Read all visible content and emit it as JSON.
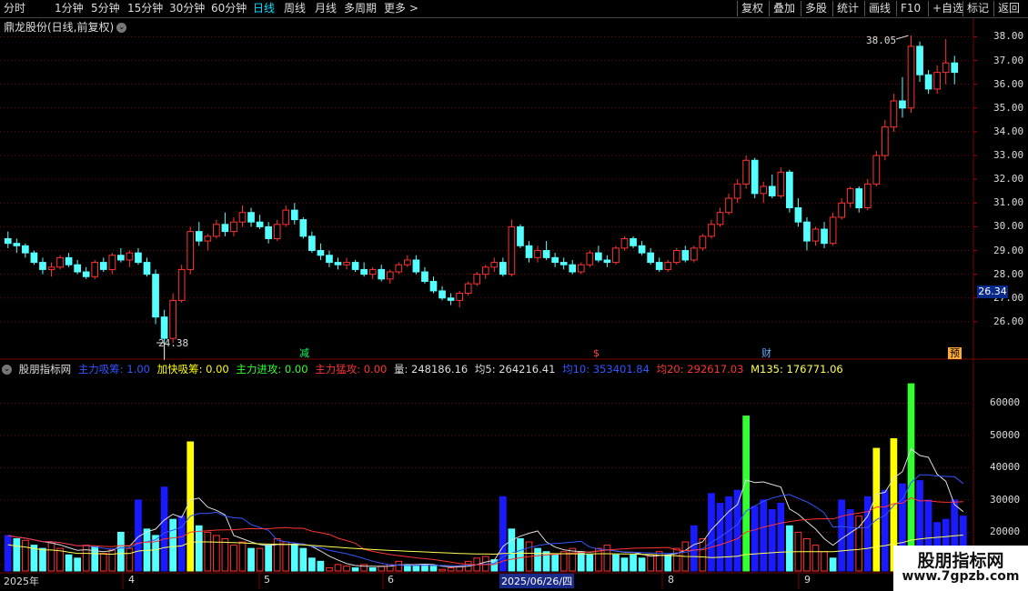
{
  "toolbar": {
    "periods": [
      "分时",
      "1分钟",
      "5分钟",
      "15分钟",
      "30分钟",
      "60分钟",
      "日线",
      "周线",
      "月线",
      "多周期",
      "更多 >"
    ],
    "active_index": 6,
    "right_buttons": [
      "复权",
      "叠加",
      "多股",
      "统计",
      "画线",
      "F10",
      "+自选",
      "标记",
      "返回"
    ]
  },
  "stock": {
    "title": "鼎龙股份(日线,前复权)",
    "dot_icon": "chevron-down-icon"
  },
  "price_axis": {
    "labels": [
      "38.00",
      "37.00",
      "36.00",
      "35.00",
      "34.00",
      "33.00",
      "32.00",
      "31.00",
      "30.00",
      "29.00",
      "28.00",
      "27.00",
      "26.00"
    ],
    "current_price": "26.34"
  },
  "annotations": {
    "high_label": "38.05",
    "low_label": "24.38"
  },
  "markers": [
    {
      "text": "减",
      "color": "#00ff66"
    },
    {
      "text": "$",
      "color": "#ff4444"
    },
    {
      "text": "财",
      "color": "#66aaff"
    },
    {
      "text": "预",
      "color": "#ffaa33"
    }
  ],
  "indicator": {
    "name": "股朋指标网",
    "items": [
      {
        "label": "主力吸筹: 1.00",
        "color": "#3355ff"
      },
      {
        "label": "加快吸筹: 0.00",
        "color": "#ffff00"
      },
      {
        "label": "主力进攻: 0.00",
        "color": "#33ff33"
      },
      {
        "label": "主力猛攻: 0.00",
        "color": "#ff3333"
      },
      {
        "label": "量: 248186.16",
        "color": "#dddddd"
      },
      {
        "label": "均5: 264216.41",
        "color": "#dddddd"
      },
      {
        "label": "均10: 353401.84",
        "color": "#3355ff"
      },
      {
        "label": "均20: 292617.03",
        "color": "#ff3333"
      },
      {
        "label": "M135: 176771.06",
        "color": "#ffff55"
      }
    ]
  },
  "volume_axis": {
    "labels": [
      "60000",
      "50000",
      "40000",
      "30000",
      "20000",
      "10000"
    ]
  },
  "dates": [
    "2025年",
    "4",
    "5",
    "6",
    "2025/06/26/四",
    "8",
    "9"
  ],
  "watermark": {
    "line1": "股朋指标网",
    "line2": "www.7gpzb.com"
  },
  "colors": {
    "up": "#ff3232",
    "down": "#54ffff",
    "grid": "#7a0000",
    "vol_blue": "#1a1aff",
    "vol_yellow": "#ffff00",
    "vol_green": "#33ff33"
  },
  "chart_data": {
    "type": "candlestick",
    "ylim": [
      25.0,
      38.4
    ],
    "candles": [
      [
        29.5,
        29.8,
        29.1,
        29.3
      ],
      [
        29.3,
        29.5,
        28.9,
        29.2
      ],
      [
        29.2,
        29.3,
        28.7,
        28.9
      ],
      [
        28.9,
        29.0,
        28.4,
        28.5
      ],
      [
        28.5,
        28.7,
        28.0,
        28.2
      ],
      [
        28.2,
        28.5,
        27.9,
        28.3
      ],
      [
        28.3,
        28.8,
        28.2,
        28.7
      ],
      [
        28.7,
        28.9,
        28.3,
        28.4
      ],
      [
        28.4,
        28.6,
        28.0,
        28.1
      ],
      [
        28.1,
        28.3,
        27.8,
        27.9
      ],
      [
        27.9,
        28.6,
        27.8,
        28.5
      ],
      [
        28.5,
        28.7,
        28.1,
        28.2
      ],
      [
        28.2,
        28.9,
        28.0,
        28.8
      ],
      [
        28.8,
        29.1,
        28.5,
        28.6
      ],
      [
        28.6,
        29.0,
        28.3,
        28.9
      ],
      [
        28.9,
        29.1,
        28.4,
        28.5
      ],
      [
        28.5,
        28.7,
        27.9,
        28.0
      ],
      [
        28.0,
        28.2,
        25.9,
        26.2
      ],
      [
        26.2,
        26.5,
        24.4,
        25.3
      ],
      [
        25.3,
        27.2,
        25.1,
        26.9
      ],
      [
        26.9,
        28.4,
        26.8,
        28.2
      ],
      [
        28.2,
        30.0,
        28.0,
        29.8
      ],
      [
        29.8,
        30.2,
        29.2,
        29.4
      ],
      [
        29.4,
        29.7,
        29.0,
        29.6
      ],
      [
        29.6,
        30.3,
        29.5,
        30.1
      ],
      [
        30.1,
        30.6,
        29.6,
        29.8
      ],
      [
        29.8,
        30.4,
        29.6,
        30.2
      ],
      [
        30.2,
        30.9,
        30.0,
        30.6
      ],
      [
        30.6,
        30.8,
        30.0,
        30.2
      ],
      [
        30.2,
        30.5,
        29.9,
        30.0
      ],
      [
        30.0,
        30.2,
        29.3,
        29.5
      ],
      [
        29.5,
        30.3,
        29.4,
        30.1
      ],
      [
        30.1,
        30.9,
        30.0,
        30.7
      ],
      [
        30.7,
        31.0,
        30.1,
        30.3
      ],
      [
        30.3,
        30.4,
        29.5,
        29.6
      ],
      [
        29.6,
        29.8,
        28.9,
        29.0
      ],
      [
        29.0,
        29.3,
        28.6,
        28.8
      ],
      [
        28.8,
        29.0,
        28.3,
        28.5
      ],
      [
        28.5,
        28.7,
        28.2,
        28.4
      ],
      [
        28.4,
        28.7,
        28.2,
        28.5
      ],
      [
        28.5,
        28.6,
        28.1,
        28.2
      ],
      [
        28.2,
        28.5,
        27.9,
        28.0
      ],
      [
        28.0,
        28.3,
        27.8,
        28.2
      ],
      [
        28.2,
        28.4,
        27.7,
        27.8
      ],
      [
        27.8,
        28.2,
        27.6,
        28.1
      ],
      [
        28.1,
        28.5,
        28.0,
        28.4
      ],
      [
        28.4,
        28.8,
        28.3,
        28.6
      ],
      [
        28.6,
        28.8,
        28.0,
        28.1
      ],
      [
        28.1,
        28.3,
        27.6,
        27.7
      ],
      [
        27.7,
        27.9,
        27.2,
        27.3
      ],
      [
        27.3,
        27.5,
        26.9,
        27.0
      ],
      [
        27.0,
        27.2,
        26.7,
        26.9
      ],
      [
        26.9,
        27.3,
        26.6,
        27.2
      ],
      [
        27.2,
        27.7,
        27.1,
        27.6
      ],
      [
        27.6,
        28.1,
        27.5,
        28.0
      ],
      [
        28.0,
        28.4,
        27.8,
        28.3
      ],
      [
        28.3,
        28.7,
        28.1,
        28.5
      ],
      [
        28.5,
        28.7,
        27.9,
        28.0
      ],
      [
        28.0,
        30.3,
        27.9,
        30.0
      ],
      [
        30.0,
        30.1,
        29.1,
        29.2
      ],
      [
        29.2,
        29.4,
        28.5,
        28.7
      ],
      [
        28.7,
        29.2,
        28.5,
        29.0
      ],
      [
        29.0,
        29.4,
        28.6,
        28.7
      ],
      [
        28.7,
        28.9,
        28.3,
        28.5
      ],
      [
        28.5,
        28.7,
        28.2,
        28.4
      ],
      [
        28.4,
        28.6,
        28.0,
        28.1
      ],
      [
        28.1,
        28.5,
        28.0,
        28.4
      ],
      [
        28.4,
        29.0,
        28.3,
        28.9
      ],
      [
        28.9,
        29.2,
        28.5,
        28.6
      ],
      [
        28.6,
        28.8,
        28.3,
        28.5
      ],
      [
        28.5,
        29.2,
        28.4,
        29.1
      ],
      [
        29.1,
        29.6,
        29.0,
        29.5
      ],
      [
        29.5,
        29.6,
        29.1,
        29.2
      ],
      [
        29.2,
        29.4,
        28.8,
        28.9
      ],
      [
        28.9,
        29.1,
        28.4,
        28.5
      ],
      [
        28.5,
        28.7,
        28.1,
        28.2
      ],
      [
        28.2,
        28.6,
        28.1,
        28.5
      ],
      [
        28.5,
        29.1,
        28.4,
        29.0
      ],
      [
        29.0,
        29.2,
        28.5,
        28.6
      ],
      [
        28.6,
        29.2,
        28.5,
        29.1
      ],
      [
        29.1,
        29.7,
        29.0,
        29.6
      ],
      [
        29.6,
        30.3,
        29.5,
        30.1
      ],
      [
        30.1,
        30.8,
        30.0,
        30.6
      ],
      [
        30.6,
        31.4,
        30.5,
        31.2
      ],
      [
        31.2,
        32.0,
        31.0,
        31.8
      ],
      [
        31.8,
        33.0,
        31.6,
        32.8
      ],
      [
        32.8,
        32.9,
        31.2,
        31.4
      ],
      [
        31.4,
        31.9,
        31.0,
        31.7
      ],
      [
        31.7,
        32.2,
        31.2,
        31.3
      ],
      [
        31.3,
        32.5,
        31.2,
        32.3
      ],
      [
        32.3,
        32.4,
        30.6,
        30.8
      ],
      [
        30.8,
        31.2,
        30.0,
        30.2
      ],
      [
        30.2,
        30.4,
        29.0,
        29.4
      ],
      [
        29.4,
        30.0,
        29.2,
        29.9
      ],
      [
        29.9,
        30.2,
        29.1,
        29.3
      ],
      [
        29.3,
        30.6,
        29.2,
        30.4
      ],
      [
        30.4,
        31.2,
        30.3,
        31.0
      ],
      [
        31.0,
        31.7,
        30.8,
        31.6
      ],
      [
        31.6,
        31.7,
        30.6,
        30.8
      ],
      [
        30.8,
        32.0,
        30.7,
        31.8
      ],
      [
        31.8,
        33.2,
        31.7,
        33.0
      ],
      [
        33.0,
        34.5,
        32.8,
        34.2
      ],
      [
        34.2,
        35.6,
        34.0,
        35.3
      ],
      [
        35.3,
        36.3,
        34.6,
        35.0
      ],
      [
        35.0,
        38.05,
        34.8,
        37.6
      ],
      [
        37.6,
        37.8,
        36.1,
        36.4
      ],
      [
        36.4,
        36.6,
        35.6,
        35.8
      ],
      [
        35.8,
        36.8,
        35.6,
        36.5
      ],
      [
        36.5,
        37.9,
        36.0,
        36.9
      ],
      [
        36.9,
        37.2,
        36.0,
        36.5
      ]
    ],
    "volumes": [
      [
        19000,
        "blue",
        1
      ],
      [
        18000,
        "cyan",
        -1
      ],
      [
        17500,
        "red",
        1
      ],
      [
        16000,
        "cyan",
        -1
      ],
      [
        15000,
        "cyan",
        -1
      ],
      [
        17000,
        "red",
        1
      ],
      [
        15000,
        "red",
        1
      ],
      [
        13000,
        "cyan",
        -1
      ],
      [
        12000,
        "cyan",
        -1
      ],
      [
        16000,
        "red",
        1
      ],
      [
        15500,
        "cyan",
        -1
      ],
      [
        13500,
        "red",
        1
      ],
      [
        14500,
        "red",
        1
      ],
      [
        20000,
        "cyan",
        -1
      ],
      [
        15000,
        "red",
        1
      ],
      [
        30000,
        "blue",
        -1
      ],
      [
        21000,
        "cyan",
        -1
      ],
      [
        19000,
        "cyan",
        -1
      ],
      [
        34000,
        "blue",
        -1
      ],
      [
        24000,
        "cyan",
        -1
      ],
      [
        25000,
        "blue",
        1
      ],
      [
        48000,
        "yellow",
        1
      ],
      [
        22000,
        "cyan",
        -1
      ],
      [
        20000,
        "red",
        1
      ],
      [
        19000,
        "red",
        1
      ],
      [
        18000,
        "red",
        1
      ],
      [
        16000,
        "red",
        1
      ],
      [
        17000,
        "red",
        1
      ],
      [
        15000,
        "cyan",
        -1
      ],
      [
        15000,
        "red",
        1
      ],
      [
        16000,
        "cyan",
        -1
      ],
      [
        18000,
        "red",
        1
      ],
      [
        17000,
        "red",
        1
      ],
      [
        16000,
        "cyan",
        -1
      ],
      [
        15000,
        "cyan",
        -1
      ],
      [
        12000,
        "cyan",
        -1
      ],
      [
        11000,
        "cyan",
        -1
      ],
      [
        9000,
        "red",
        1
      ],
      [
        10000,
        "red",
        1
      ],
      [
        9500,
        "red",
        1
      ],
      [
        9000,
        "cyan",
        -1
      ],
      [
        10000,
        "red",
        1
      ],
      [
        9000,
        "cyan",
        -1
      ],
      [
        9500,
        "red",
        1
      ],
      [
        10000,
        "red",
        1
      ],
      [
        11000,
        "red",
        1
      ],
      [
        10000,
        "cyan",
        -1
      ],
      [
        9500,
        "cyan",
        -1
      ],
      [
        10000,
        "cyan",
        -1
      ],
      [
        9500,
        "cyan",
        -1
      ],
      [
        8500,
        "red",
        1
      ],
      [
        9000,
        "red",
        1
      ],
      [
        9500,
        "red",
        1
      ],
      [
        11000,
        "red",
        1
      ],
      [
        12000,
        "red",
        1
      ],
      [
        12500,
        "red",
        1
      ],
      [
        11500,
        "cyan",
        -1
      ],
      [
        31000,
        "blue",
        1
      ],
      [
        21000,
        "cyan",
        -1
      ],
      [
        18000,
        "cyan",
        -1
      ],
      [
        17000,
        "red",
        1
      ],
      [
        15000,
        "cyan",
        -1
      ],
      [
        14000,
        "cyan",
        -1
      ],
      [
        13000,
        "cyan",
        -1
      ],
      [
        14000,
        "red",
        1
      ],
      [
        15000,
        "red",
        1
      ],
      [
        14000,
        "cyan",
        -1
      ],
      [
        13000,
        "cyan",
        -1
      ],
      [
        15000,
        "red",
        1
      ],
      [
        16000,
        "red",
        1
      ],
      [
        13000,
        "cyan",
        -1
      ],
      [
        12000,
        "cyan",
        -1
      ],
      [
        13000,
        "cyan",
        -1
      ],
      [
        12000,
        "cyan",
        -1
      ],
      [
        13000,
        "red",
        1
      ],
      [
        14000,
        "red",
        1
      ],
      [
        13000,
        "cyan",
        -1
      ],
      [
        15000,
        "red",
        1
      ],
      [
        17000,
        "red",
        1
      ],
      [
        22000,
        "blue",
        1
      ],
      [
        18000,
        "red",
        1
      ],
      [
        32000,
        "blue",
        1
      ],
      [
        29000,
        "blue",
        1
      ],
      [
        31000,
        "blue",
        1
      ],
      [
        33000,
        "blue",
        1
      ],
      [
        56000,
        "green",
        1
      ],
      [
        28000,
        "blue",
        -1
      ],
      [
        30000,
        "blue",
        1
      ],
      [
        27000,
        "blue",
        -1
      ],
      [
        29000,
        "blue",
        1
      ],
      [
        22000,
        "cyan",
        -1
      ],
      [
        20000,
        "red",
        1
      ],
      [
        18000,
        "red",
        1
      ],
      [
        16000,
        "red",
        1
      ],
      [
        14000,
        "red",
        1
      ],
      [
        12000,
        "cyan",
        -1
      ],
      [
        30000,
        "blue",
        1
      ],
      [
        27000,
        "blue",
        1
      ],
      [
        25000,
        "red",
        1
      ],
      [
        31000,
        "blue",
        1
      ],
      [
        46000,
        "yellow",
        1
      ],
      [
        33000,
        "blue",
        1
      ],
      [
        49000,
        "yellow",
        1
      ],
      [
        35000,
        "blue",
        1
      ],
      [
        66000,
        "green",
        1
      ],
      [
        36000,
        "blue",
        1
      ],
      [
        30000,
        "blue",
        1
      ],
      [
        23000,
        "blue",
        -1
      ],
      [
        24000,
        "blue",
        1
      ],
      [
        30000,
        "blue",
        1
      ],
      [
        25000,
        "blue",
        1
      ]
    ],
    "volume_ylim": [
      8000,
      68000
    ]
  }
}
